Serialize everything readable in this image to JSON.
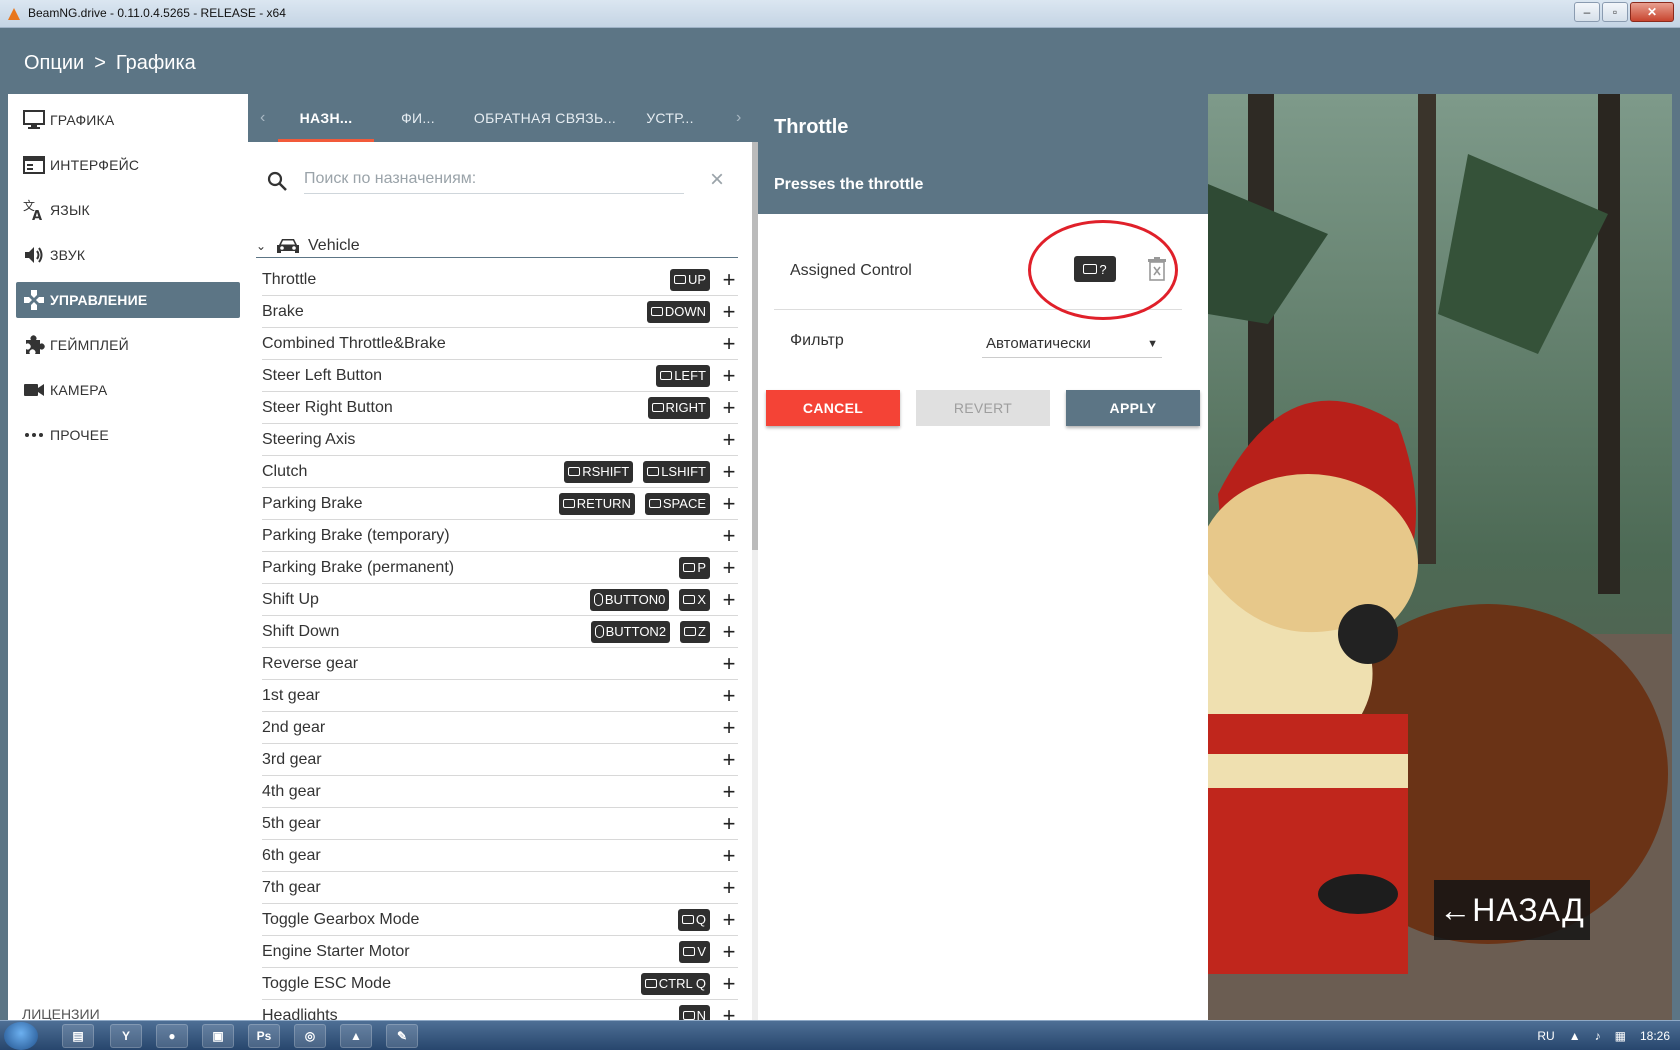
{
  "window": {
    "title": "BeamNG.drive - 0.11.0.4.5265 - RELEASE - x64"
  },
  "header": {
    "crumb_root": "Опции",
    "crumb_sep": ">",
    "crumb_current": "Графика"
  },
  "sidebar": {
    "items": [
      {
        "label": "ГРАФИКА",
        "icon": "monitor-icon"
      },
      {
        "label": "ИНТЕРФЕЙС",
        "icon": "interface-icon"
      },
      {
        "label": "ЯЗЫК",
        "icon": "translate-icon"
      },
      {
        "label": "ЗВУК",
        "icon": "speaker-icon"
      },
      {
        "label": "УПРАВЛЕНИЕ",
        "icon": "gamepad-icon",
        "active": true
      },
      {
        "label": "ГЕЙМПЛЕЙ",
        "icon": "puzzle-icon"
      },
      {
        "label": "КАМЕРА",
        "icon": "camera-icon"
      },
      {
        "label": "ПРОЧЕЕ",
        "icon": "more-icon"
      }
    ],
    "footer": "ЛИЦЕНЗИИ"
  },
  "tabs": [
    {
      "label": "НАЗН...",
      "active": true
    },
    {
      "label": "ФИ..."
    },
    {
      "label": "ОБРАТНАЯ СВЯЗЬ..."
    },
    {
      "label": "УСТР..."
    }
  ],
  "search": {
    "placeholder": "Поиск по назначениям:"
  },
  "group": {
    "label": "Vehicle"
  },
  "bindings": [
    {
      "label": "Throttle",
      "keys": [
        {
          "t": "kb",
          "v": "UP"
        }
      ]
    },
    {
      "label": "Brake",
      "keys": [
        {
          "t": "kb",
          "v": "DOWN"
        }
      ]
    },
    {
      "label": "Combined Throttle&Brake",
      "keys": []
    },
    {
      "label": "Steer Left Button",
      "keys": [
        {
          "t": "kb",
          "v": "LEFT"
        }
      ]
    },
    {
      "label": "Steer Right Button",
      "keys": [
        {
          "t": "kb",
          "v": "RIGHT"
        }
      ]
    },
    {
      "label": "Steering Axis",
      "keys": []
    },
    {
      "label": "Clutch",
      "keys": [
        {
          "t": "kb",
          "v": "RSHIFT"
        },
        {
          "t": "kb",
          "v": "LSHIFT"
        }
      ]
    },
    {
      "label": "Parking Brake",
      "keys": [
        {
          "t": "kb",
          "v": "RETURN"
        },
        {
          "t": "kb",
          "v": "SPACE"
        }
      ]
    },
    {
      "label": "Parking Brake (temporary)",
      "keys": []
    },
    {
      "label": "Parking Brake (permanent)",
      "keys": [
        {
          "t": "kb",
          "v": "P"
        }
      ]
    },
    {
      "label": "Shift Up",
      "keys": [
        {
          "t": "ms",
          "v": "BUTTON0"
        },
        {
          "t": "kb",
          "v": "X"
        }
      ]
    },
    {
      "label": "Shift Down",
      "keys": [
        {
          "t": "ms",
          "v": "BUTTON2"
        },
        {
          "t": "kb",
          "v": "Z"
        }
      ]
    },
    {
      "label": "Reverse gear",
      "keys": []
    },
    {
      "label": "1st gear",
      "keys": []
    },
    {
      "label": "2nd gear",
      "keys": []
    },
    {
      "label": "3rd gear",
      "keys": []
    },
    {
      "label": "4th gear",
      "keys": []
    },
    {
      "label": "5th gear",
      "keys": []
    },
    {
      "label": "6th gear",
      "keys": []
    },
    {
      "label": "7th gear",
      "keys": []
    },
    {
      "label": "Toggle Gearbox Mode",
      "keys": [
        {
          "t": "kb",
          "v": "Q"
        }
      ]
    },
    {
      "label": "Engine Starter Motor",
      "keys": [
        {
          "t": "kb",
          "v": "V"
        }
      ]
    },
    {
      "label": "Toggle ESC Mode",
      "keys": [
        {
          "t": "kb",
          "v": "CTRL Q"
        }
      ]
    },
    {
      "label": "Headlights",
      "keys": [
        {
          "t": "kb",
          "v": "N"
        }
      ]
    }
  ],
  "detail": {
    "title": "Throttle",
    "subtitle": "Presses the throttle",
    "assigned_label": "Assigned Control",
    "assigned_key": "?",
    "filter_label": "Фильтр",
    "filter_value": "Автоматически",
    "cancel": "CANCEL",
    "revert": "REVERT",
    "apply": "APPLY"
  },
  "scene": {
    "back_label": "←НАЗАД"
  },
  "taskbar": {
    "lang": "RU",
    "time": "18:26"
  },
  "colors": {
    "primary": "#5c7585",
    "accent": "#f25a3a",
    "cancel": "#f44336",
    "annotation": "#e0202a"
  }
}
